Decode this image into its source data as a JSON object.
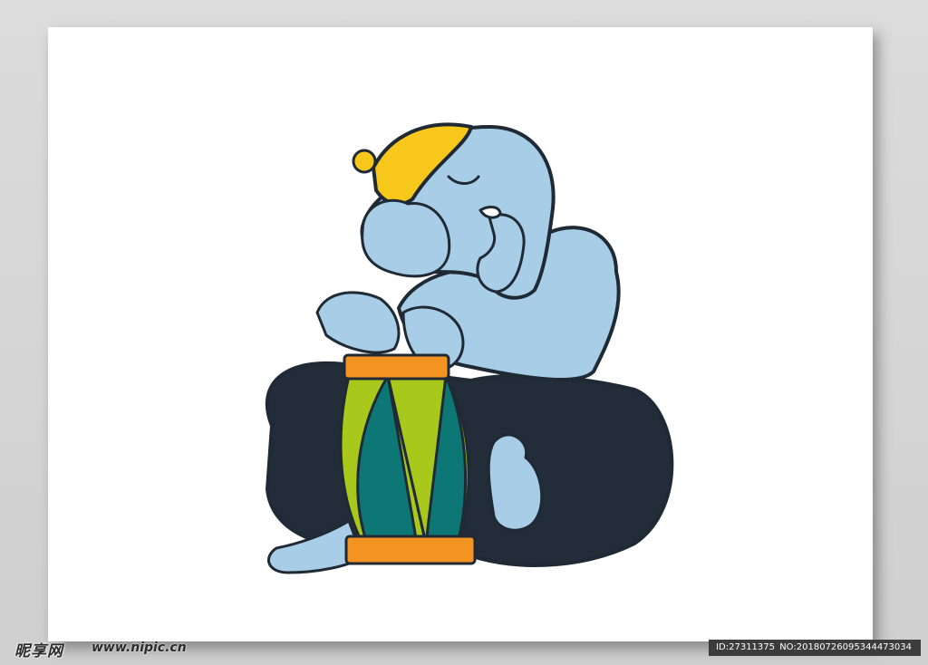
{
  "watermark": {
    "site_logo": "昵享网",
    "site_url": "www.nipic.cn",
    "id_label": "ID:27311375",
    "no_label": "NO:20180726095344473034"
  },
  "colors": {
    "background": "#d6d6d6",
    "artboard": "#ffffff",
    "elephant_skin": "#a8cde6",
    "outline": "#1f2a35",
    "pants": "#232d3a",
    "cap": "#f7c81b",
    "drum_band": "#f39322",
    "drum_green": "#a8c81b",
    "drum_teal": "#0c7775"
  },
  "icons": [
    "elephant-drummer-illustration"
  ]
}
